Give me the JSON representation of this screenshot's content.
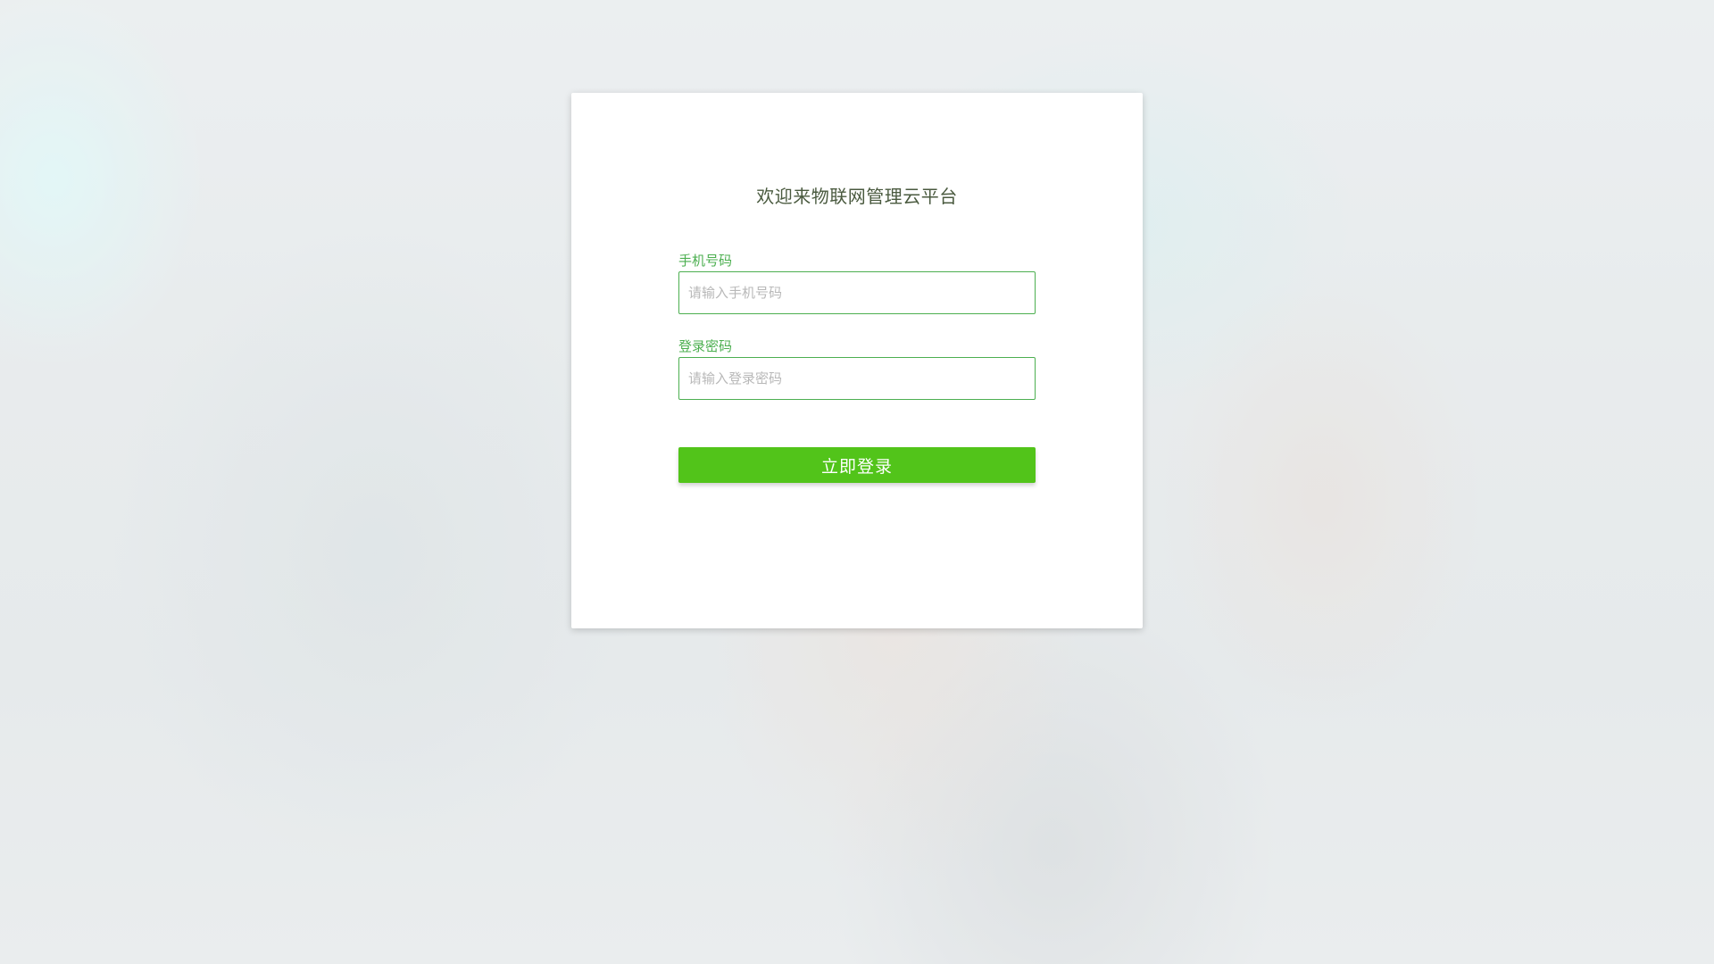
{
  "login": {
    "title": "欢迎来物联网管理云平台",
    "phone": {
      "label": "手机号码",
      "value": "",
      "placeholder": "请输入手机号码"
    },
    "password": {
      "label": "登录密码",
      "value": "",
      "placeholder": "请输入登录密码"
    },
    "submit_label": "立即登录"
  },
  "colors": {
    "accent": "#52c41a",
    "label": "#4caf50",
    "title": "#4a5a3f"
  }
}
